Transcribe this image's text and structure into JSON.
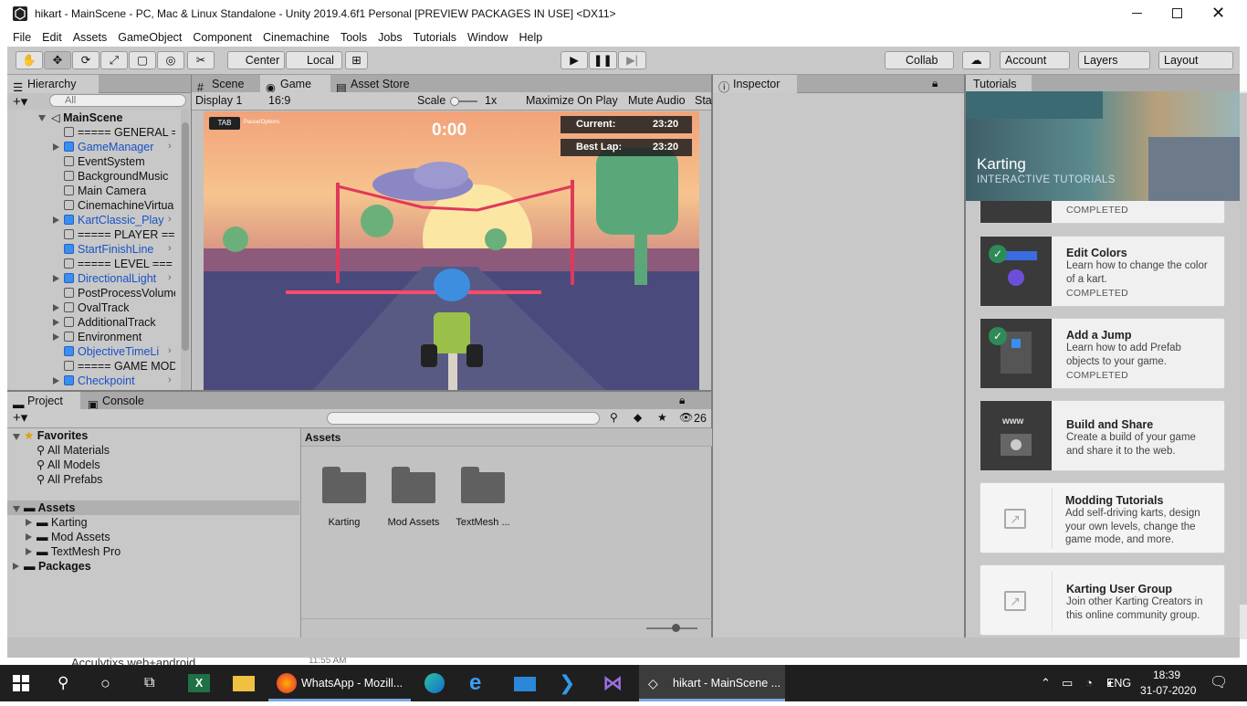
{
  "window": {
    "title": "hikart - MainScene - PC, Mac & Linux Standalone - Unity 2019.4.6f1 Personal [PREVIEW PACKAGES IN USE] <DX11>"
  },
  "menu": [
    "File",
    "Edit",
    "Assets",
    "GameObject",
    "Component",
    "Cinemachine",
    "Tools",
    "Jobs",
    "Tutorials",
    "Window",
    "Help"
  ],
  "toolbar": {
    "center": "Center",
    "local": "Local",
    "collab": "Collab",
    "account": "Account",
    "layers": "Layers",
    "layout": "Layout"
  },
  "hierarchy": {
    "tab": "Hierarchy",
    "search_placeholder": "All",
    "scene": "MainScene",
    "items": [
      {
        "label": "===== GENERAL =",
        "blue": false,
        "arrow": false,
        "chev": false
      },
      {
        "label": "GameManager",
        "blue": true,
        "arrow": true,
        "chev": true
      },
      {
        "label": "EventSystem",
        "blue": false,
        "arrow": false,
        "chev": false
      },
      {
        "label": "BackgroundMusic",
        "blue": false,
        "arrow": false,
        "chev": false
      },
      {
        "label": "Main Camera",
        "blue": false,
        "arrow": false,
        "chev": false
      },
      {
        "label": "CinemachineVirtua",
        "blue": false,
        "arrow": false,
        "chev": false
      },
      {
        "label": "KartClassic_Play",
        "blue": true,
        "arrow": true,
        "chev": true
      },
      {
        "label": "===== PLAYER ==",
        "blue": false,
        "arrow": false,
        "chev": false
      },
      {
        "label": "StartFinishLine",
        "blue": true,
        "arrow": false,
        "chev": true
      },
      {
        "label": "===== LEVEL ===",
        "blue": false,
        "arrow": false,
        "chev": false
      },
      {
        "label": "DirectionalLight",
        "blue": true,
        "arrow": true,
        "chev": true
      },
      {
        "label": "PostProcessVolume",
        "blue": false,
        "arrow": false,
        "chev": false
      },
      {
        "label": "OvalTrack",
        "blue": false,
        "arrow": true,
        "chev": false
      },
      {
        "label": "AdditionalTrack",
        "blue": false,
        "arrow": true,
        "chev": false
      },
      {
        "label": "Environment",
        "blue": false,
        "arrow": true,
        "chev": false
      },
      {
        "label": "ObjectiveTimeLi",
        "blue": true,
        "arrow": false,
        "chev": true
      },
      {
        "label": "===== GAME MOD",
        "blue": false,
        "arrow": false,
        "chev": false
      },
      {
        "label": "Checkpoint",
        "blue": true,
        "arrow": true,
        "chev": true
      }
    ]
  },
  "game": {
    "tabs": [
      "Scene",
      "Game",
      "Asset Store"
    ],
    "display": "Display 1",
    "aspect": "16:9",
    "scale_label": "Scale",
    "scale_value": "1x",
    "maximize": "Maximize On Play",
    "mute": "Mute Audio",
    "stats": "Sta",
    "hud": {
      "tab": "TAB",
      "tab_hint": "Pause/Options",
      "timer": "0:00",
      "current_label": "Current:",
      "current_value": "23:20",
      "best_label": "Best Lap:",
      "best_value": "23:20"
    }
  },
  "inspector": {
    "tab": "Inspector"
  },
  "tutorials": {
    "tab": "Tutorials",
    "banner_title": "Karting",
    "banner_sub": "INTERACTIVE TUTORIALS",
    "cards": [
      {
        "title": "",
        "desc": "",
        "status": "COMPLETED"
      },
      {
        "title": "Edit Colors",
        "desc": "Learn how to change the color of a kart.",
        "status": "COMPLETED"
      },
      {
        "title": "Add a Jump",
        "desc": "Learn how to add Prefab objects to your game.",
        "status": "COMPLETED"
      },
      {
        "title": "Build and Share",
        "desc": "Create a build of your game and share it to the web.",
        "status": "",
        "badge": "www"
      },
      {
        "title": "Modding Tutorials",
        "desc": "Add self-driving karts, design your own levels, change the game mode, and more.",
        "status": ""
      },
      {
        "title": "Karting User Group",
        "desc": "Join other Karting Creators in this online community group.",
        "status": ""
      }
    ]
  },
  "project": {
    "tabs": [
      "Project",
      "Console"
    ],
    "count": "26",
    "favorites": {
      "label": "Favorites",
      "items": [
        "All Materials",
        "All Models",
        "All Prefabs"
      ]
    },
    "assets": {
      "label": "Assets",
      "items": [
        "Karting",
        "Mod Assets",
        "TextMesh Pro"
      ]
    },
    "packages": "Packages",
    "breadcrumb": "Assets",
    "folders": [
      "Karting",
      "Mod Assets",
      "TextMesh ..."
    ]
  },
  "background_text": "Acculytixs web+android",
  "background_time": "11:55 AM",
  "taskbar": {
    "items": [
      "WhatsApp - Mozill...",
      "hikart - MainScene ..."
    ],
    "lang": "ENG",
    "time": "18:39",
    "date": "31-07-2020"
  }
}
